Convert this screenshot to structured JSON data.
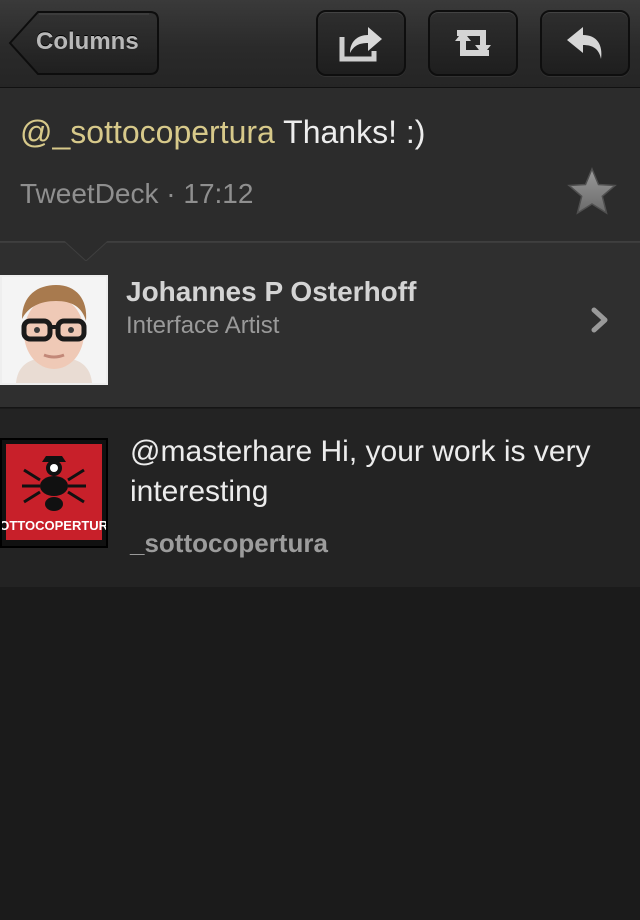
{
  "toolbar": {
    "back_label": "Columns",
    "buttons": [
      {
        "icon": "share-icon"
      },
      {
        "icon": "retweet-icon"
      },
      {
        "icon": "reply-icon"
      }
    ]
  },
  "tweet": {
    "mention": "@_sottocopertura",
    "text": " Thanks! :)",
    "meta": "TweetDeck · 17:12",
    "favorite_icon": "star-icon"
  },
  "author": {
    "name": "Johannes P Osterhoff",
    "bio": "Interface Artist"
  },
  "in_reply_to": {
    "text": "@masterhare Hi, your work is very interesting",
    "username": "_sottocopertura",
    "avatar_logo_text": "SOTTOCOPERTURA"
  },
  "colors": {
    "mention": "#d7c98a",
    "background": "#1b1b1b",
    "detail_bg": "#2c2c2c",
    "logo_red": "#c8202a"
  }
}
